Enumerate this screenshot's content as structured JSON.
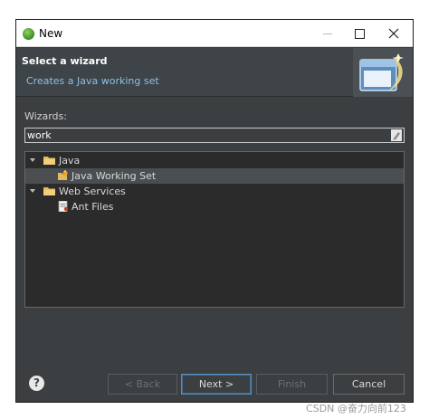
{
  "window": {
    "title": "New"
  },
  "header": {
    "title": "Select a wizard",
    "description": "Creates a Java working set"
  },
  "wizards": {
    "label": "Wizards:",
    "filter_value": "work"
  },
  "tree": {
    "items": [
      {
        "label": "Java",
        "icon": "folder-icon",
        "expanded": true
      },
      {
        "label": "Java Working Set",
        "icon": "working-set-icon",
        "selected": true
      },
      {
        "label": "Web Services",
        "icon": "folder-icon",
        "expanded": true
      },
      {
        "label": "Ant Files",
        "icon": "ant-file-icon"
      }
    ]
  },
  "buttons": {
    "help": "?",
    "back": "< Back",
    "next": "Next >",
    "finish": "Finish",
    "cancel": "Cancel"
  },
  "watermark": "CSDN @奋力向前123"
}
